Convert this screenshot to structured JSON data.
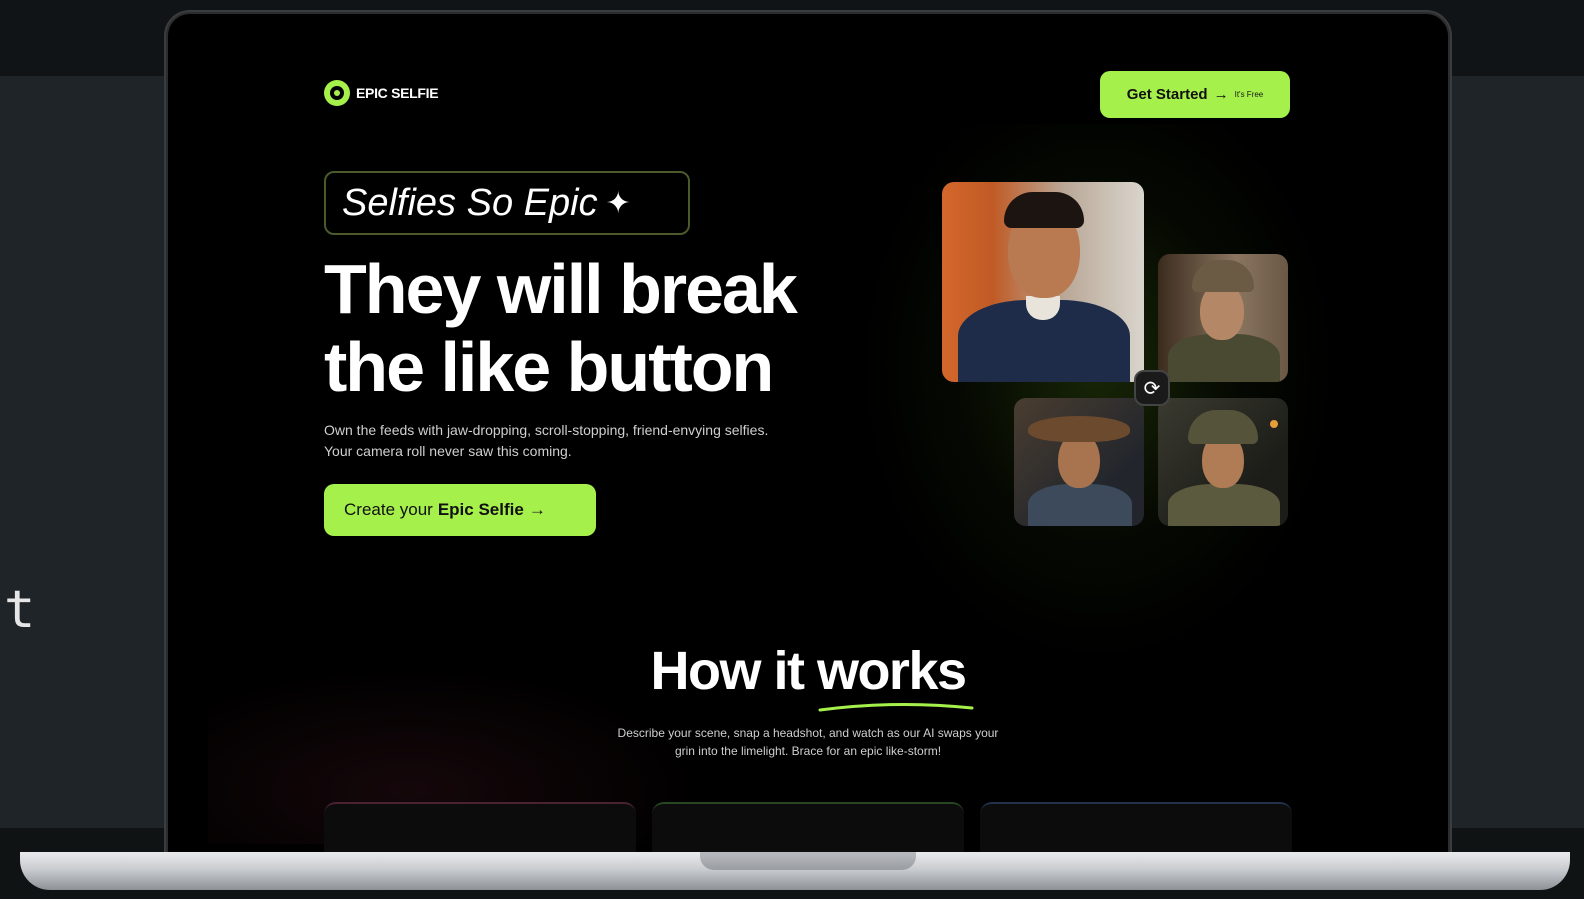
{
  "edge_text": "t",
  "nav": {
    "logo_text": "EPIC SELFIE",
    "cta_label": "Get Started",
    "cta_arrow": "→",
    "cta_note": "It's Free"
  },
  "hero": {
    "badge_text": "Selfies So Epic",
    "badge_icon": "sparkle-icon",
    "headline_line1": "They will break",
    "headline_line2": "the like button",
    "subtext_line1": "Own the feeds with jaw-dropping, scroll-stopping, friend-envying selfies.",
    "subtext_line2": "Your camera roll never saw this coming.",
    "cta_prefix": "Create your",
    "cta_bold": "Epic Selfie",
    "cta_arrow": "→"
  },
  "how_it_works": {
    "title": "How it works",
    "text_line1": "Describe your scene, snap a headshot, and watch as our AI swaps your",
    "text_line2": "grin into the limelight. Brace for an epic like-storm!"
  },
  "colors": {
    "accent": "#a6f04b",
    "screen_bg": "#000000"
  }
}
